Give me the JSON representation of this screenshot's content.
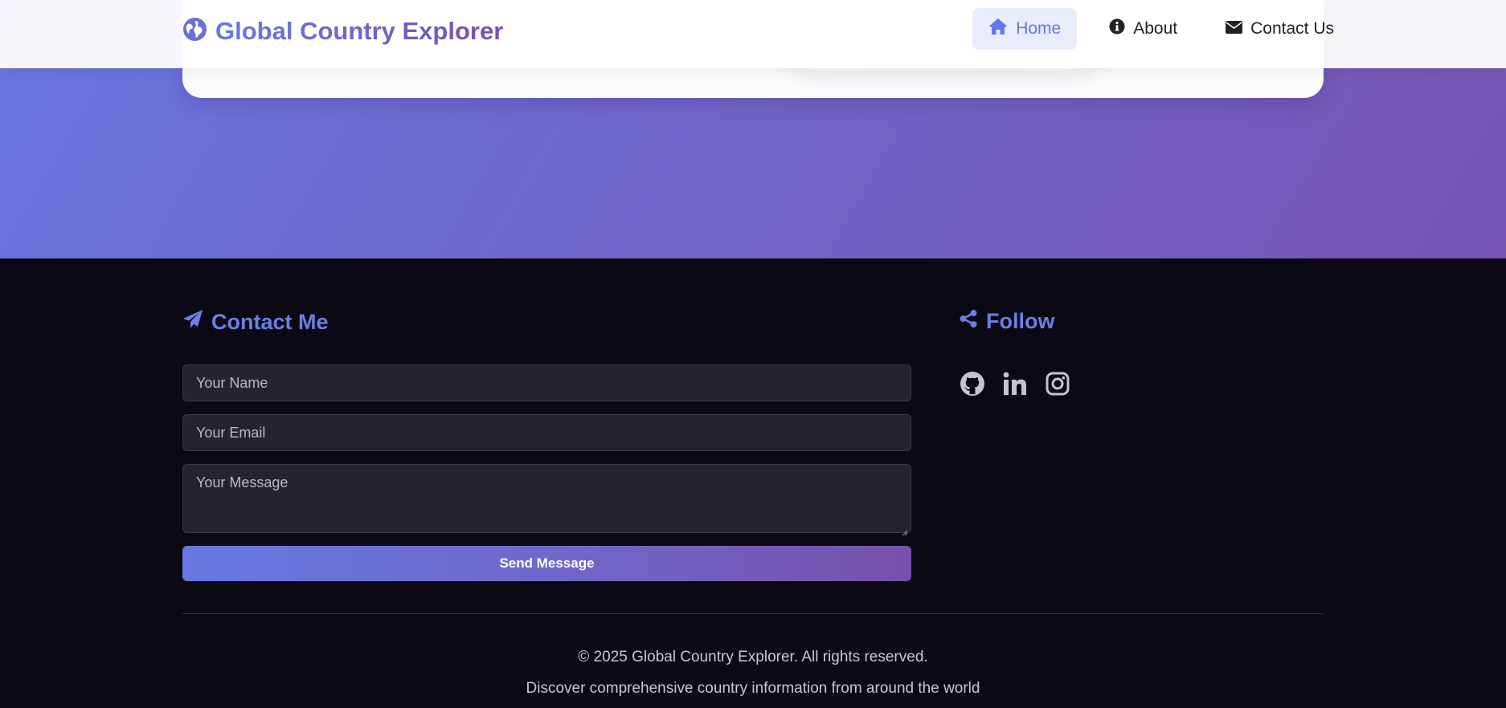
{
  "brand": {
    "title": "Global Country Explorer"
  },
  "nav": {
    "items": [
      {
        "label": "Home",
        "icon": "home-icon",
        "active": true
      },
      {
        "label": "About",
        "icon": "info-icon",
        "active": false
      },
      {
        "label": "Contact Us",
        "icon": "envelope-icon",
        "active": false
      }
    ]
  },
  "contact": {
    "title": "Contact Me",
    "name_placeholder": "Your Name",
    "email_placeholder": "Your Email",
    "message_placeholder": "Your Message",
    "send_label": "Send Message"
  },
  "follow": {
    "title": "Follow",
    "socials": [
      "github-icon",
      "linkedin-icon",
      "instagram-icon"
    ]
  },
  "footer": {
    "copyright": "© 2025 Global Country Explorer. All rights reserved.",
    "tagline": "Discover comprehensive country information from around the world"
  },
  "colors": {
    "accent": "#6e7ee6",
    "gradient_start": "#6a76e0",
    "gradient_end": "#7655b3",
    "footer_bg": "#0b0a14"
  }
}
